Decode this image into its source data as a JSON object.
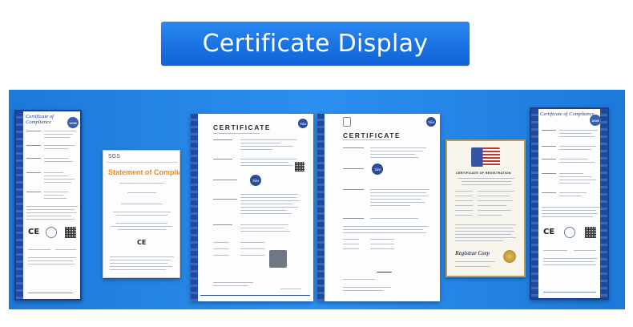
{
  "banner": {
    "title": "Certificate Display"
  },
  "certificates": {
    "coc_left": {
      "heading": "Certificate of Compliance"
    },
    "sgs": {
      "brand": "SGS",
      "heading": "Statement of Compliance"
    },
    "tuv_one": {
      "heading": "CERTIFICATE"
    },
    "tuv_two": {
      "heading": "CERTIFICATE"
    },
    "fda": {
      "heading": "CERTIFICATE OF REGISTRATION",
      "footer": "Registrar Corp"
    },
    "coc_right": {
      "heading": "Certificate of Compliance"
    }
  },
  "colors": {
    "banner_top": "#2a86f1",
    "banner_bottom": "#0f63d6",
    "showcase_bg": "#2c8ff0",
    "compliance_border": "#1c3f8f",
    "sgs_orange": "#f08a1c",
    "tuv_blue": "#2a4d9b"
  },
  "icons": [
    "tuv-seal-icon",
    "ce-mark-icon",
    "qr-code-icon",
    "fda-eagle-flag-icon",
    "signature-icon"
  ]
}
